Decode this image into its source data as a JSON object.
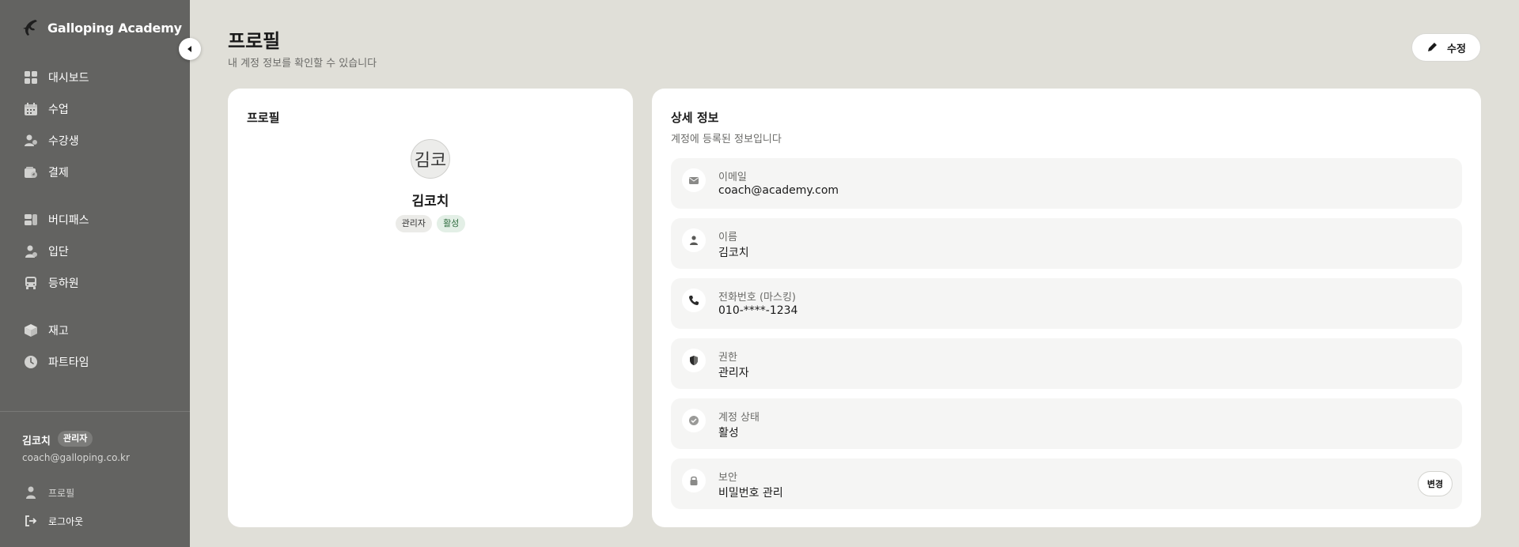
{
  "sidebar": {
    "brand": "Galloping Academy",
    "nav": [
      {
        "label": "대시보드",
        "icon": "dashboard-icon"
      },
      {
        "label": "수업",
        "icon": "calendar-icon"
      },
      {
        "label": "수강생",
        "icon": "students-icon"
      },
      {
        "label": "결제",
        "icon": "payment-icon"
      },
      {
        "label": "버디패스",
        "icon": "buddy-pass-icon"
      },
      {
        "label": "입단",
        "icon": "enrollment-icon"
      },
      {
        "label": "등하원",
        "icon": "bus-icon"
      },
      {
        "label": "재고",
        "icon": "inventory-box-icon"
      },
      {
        "label": "파트타임",
        "icon": "clock-icon"
      }
    ],
    "user": {
      "name": "김코치",
      "role": "관리자",
      "email": "coach@galloping.co.kr"
    },
    "footer": {
      "profile": "프로필",
      "logout": "로그아웃"
    }
  },
  "header": {
    "title": "프로필",
    "subtitle": "내 계정 정보를 확인할 수 있습니다",
    "edit_label": "수정"
  },
  "profile_card": {
    "title": "프로필",
    "avatar_text": "김코",
    "name": "김코치",
    "role_badge": "관리자",
    "status_badge": "활성"
  },
  "detail_card": {
    "title": "상세 정보",
    "description": "계정에 등록된 정보입니다",
    "rows": [
      {
        "label": "이메일",
        "value": "coach@academy.com",
        "icon": "mail-icon"
      },
      {
        "label": "이름",
        "value": "김코치",
        "icon": "person-icon"
      },
      {
        "label": "전화번호 (마스킹)",
        "value": "010-****-1234",
        "icon": "phone-icon"
      },
      {
        "label": "권한",
        "value": "관리자",
        "icon": "shield-icon"
      },
      {
        "label": "계정 상태",
        "value": "활성",
        "icon": "check-circle-icon"
      },
      {
        "label": "보안",
        "value": "비밀번호 관리",
        "icon": "lock-icon",
        "action": "변경"
      }
    ]
  }
}
